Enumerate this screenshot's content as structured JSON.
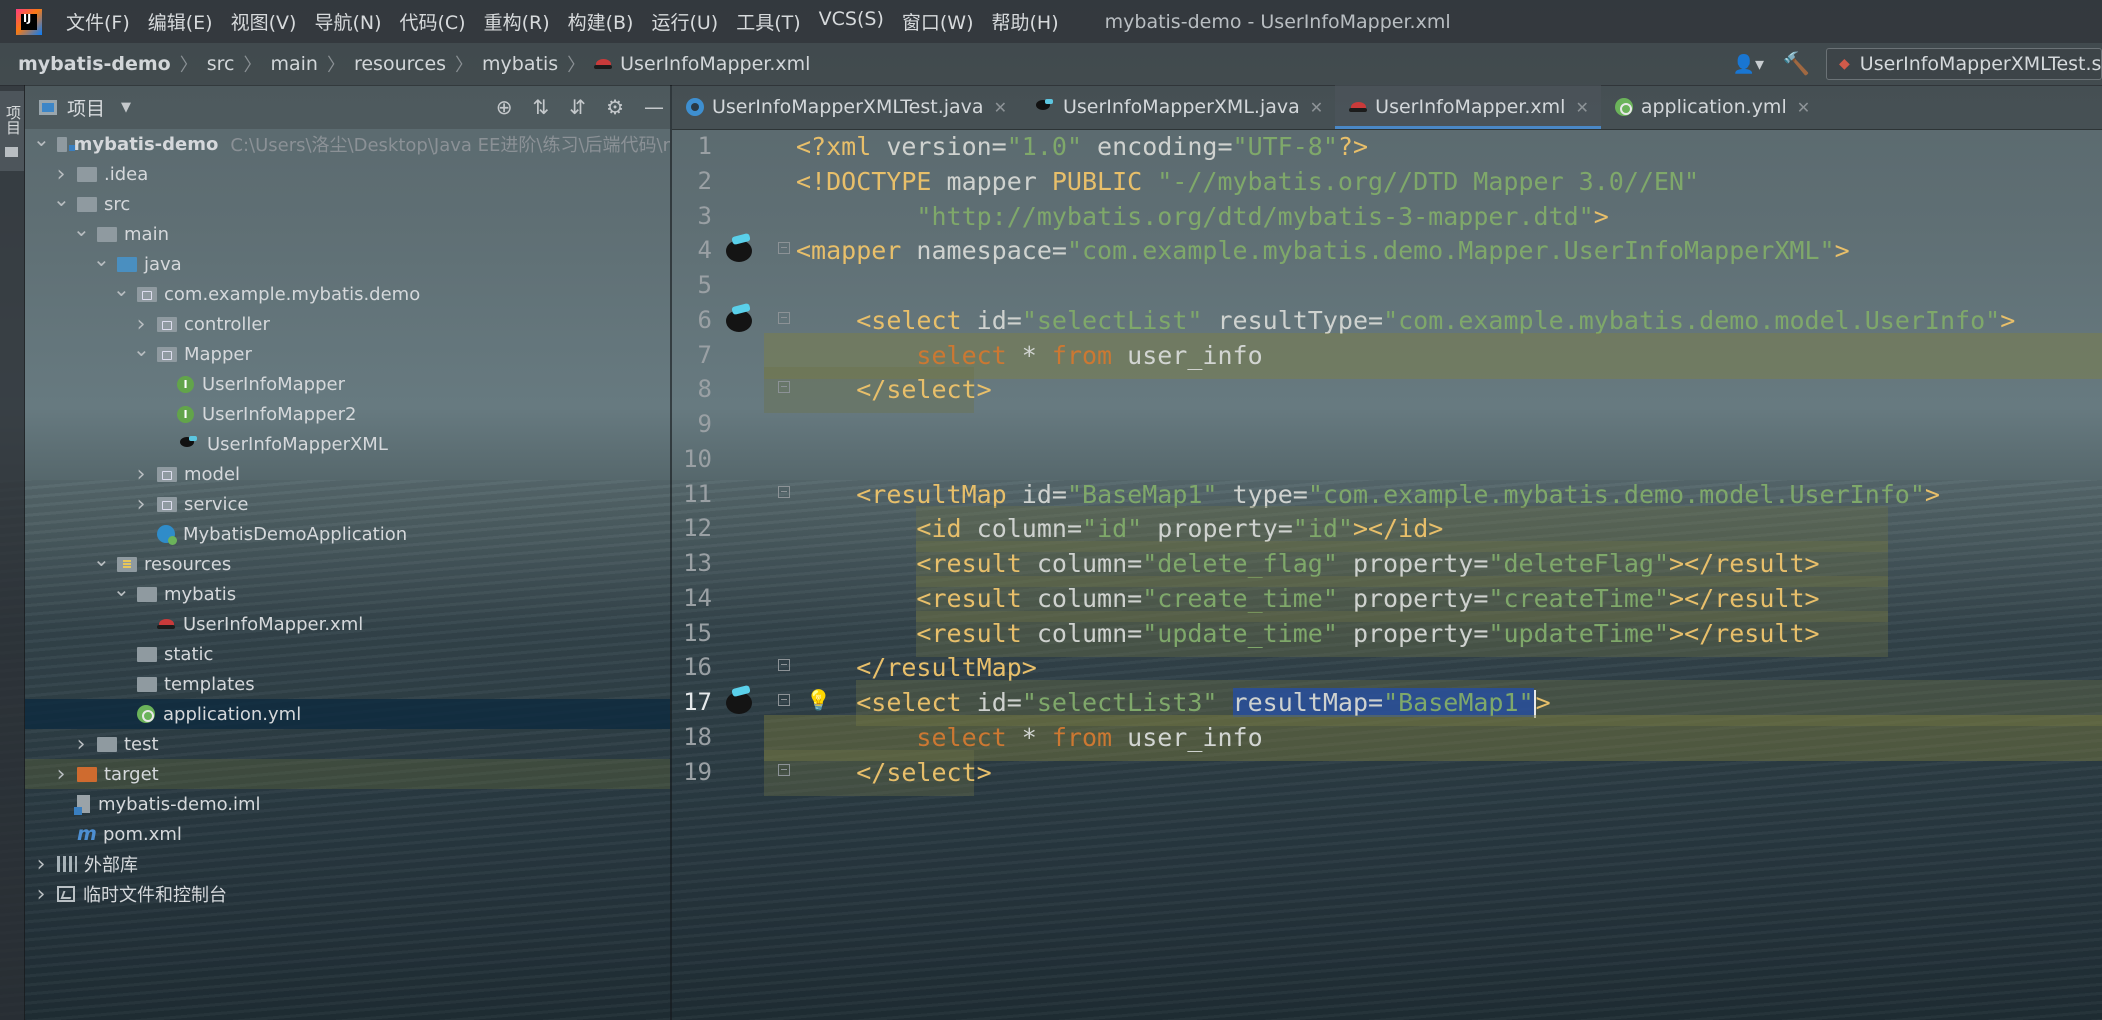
{
  "app": {
    "logo_label": "IJ",
    "window_title": "mybatis-demo - UserInfoMapper.xml",
    "menu": [
      "文件(F)",
      "编辑(E)",
      "视图(V)",
      "导航(N)",
      "代码(C)",
      "重构(R)",
      "构建(B)",
      "运行(U)",
      "工具(T)",
      "VCS(S)",
      "窗口(W)",
      "帮助(H)"
    ]
  },
  "breadcrumb": [
    "mybatis-demo",
    "src",
    "main",
    "resources",
    "mybatis",
    "UserInfoMapper.xml"
  ],
  "toolbar": {
    "run_config": "UserInfoMapperXMLTest.s"
  },
  "tool_strip": {
    "label": "项目"
  },
  "project_panel": {
    "title": "项目",
    "tree": [
      {
        "label": "mybatis-demo",
        "hint": "C:\\Users\\洛尘\\Desktop\\Java EE进阶\\练习\\后端代码\\r",
        "depth": 0,
        "arrow": "open",
        "icon": "module-folder",
        "bold": true
      },
      {
        "label": ".idea",
        "depth": 1,
        "arrow": "closed",
        "icon": "folder"
      },
      {
        "label": "src",
        "depth": 1,
        "arrow": "open",
        "icon": "folder"
      },
      {
        "label": "main",
        "depth": 2,
        "arrow": "open",
        "icon": "folder"
      },
      {
        "label": "java",
        "depth": 3,
        "arrow": "open",
        "icon": "source-folder"
      },
      {
        "label": "com.example.mybatis.demo",
        "depth": 4,
        "arrow": "open",
        "icon": "package"
      },
      {
        "label": "controller",
        "depth": 5,
        "arrow": "closed",
        "icon": "package"
      },
      {
        "label": "Mapper",
        "depth": 5,
        "arrow": "open",
        "icon": "package"
      },
      {
        "label": "UserInfoMapper",
        "depth": 6,
        "arrow": "none",
        "icon": "interface"
      },
      {
        "label": "UserInfoMapper2",
        "depth": 6,
        "arrow": "none",
        "icon": "interface"
      },
      {
        "label": "UserInfoMapperXML",
        "depth": 6,
        "arrow": "none",
        "icon": "mybatis"
      },
      {
        "label": "model",
        "depth": 5,
        "arrow": "closed",
        "icon": "package"
      },
      {
        "label": "service",
        "depth": 5,
        "arrow": "closed",
        "icon": "package"
      },
      {
        "label": "MybatisDemoApplication",
        "depth": 5,
        "arrow": "none",
        "icon": "spring-app"
      },
      {
        "label": "resources",
        "depth": 3,
        "arrow": "open",
        "icon": "resources"
      },
      {
        "label": "mybatis",
        "depth": 4,
        "arrow": "open",
        "icon": "folder"
      },
      {
        "label": "UserInfoMapper.xml",
        "depth": 5,
        "arrow": "none",
        "icon": "xml"
      },
      {
        "label": "static",
        "depth": 4,
        "arrow": "none",
        "icon": "folder"
      },
      {
        "label": "templates",
        "depth": 4,
        "arrow": "none",
        "icon": "folder"
      },
      {
        "label": "application.yml",
        "depth": 4,
        "arrow": "none",
        "icon": "yml",
        "selected": true
      },
      {
        "label": "test",
        "depth": 2,
        "arrow": "closed",
        "icon": "folder"
      },
      {
        "label": "target",
        "depth": 1,
        "arrow": "closed",
        "icon": "excluded-folder",
        "tinted": true
      },
      {
        "label": "mybatis-demo.iml",
        "depth": 1,
        "arrow": "none",
        "icon": "iml"
      },
      {
        "label": "pom.xml",
        "depth": 1,
        "arrow": "none",
        "icon": "maven"
      },
      {
        "label": "外部库",
        "depth": 0,
        "arrow": "closed",
        "icon": "library"
      },
      {
        "label": "临时文件和控制台",
        "depth": 0,
        "arrow": "closed",
        "icon": "scratch"
      }
    ]
  },
  "tabs": [
    {
      "label": "UserInfoMapperXMLTest.java",
      "icon": "java-class",
      "active": false
    },
    {
      "label": "UserInfoMapperXML.java",
      "icon": "mybatis",
      "active": false
    },
    {
      "label": "UserInfoMapper.xml",
      "icon": "xml",
      "active": true
    },
    {
      "label": "application.yml",
      "icon": "yml",
      "active": false
    }
  ],
  "editor": {
    "current_line": 17,
    "lines": [
      {
        "n": 1,
        "tokens": [
          [
            "tag",
            "<?xml "
          ],
          [
            "attr",
            "version"
          ],
          [
            "eq",
            "="
          ],
          [
            "val",
            "\"1.0\""
          ],
          [
            "attr",
            " encoding"
          ],
          [
            "eq",
            "="
          ],
          [
            "val",
            "\"UTF-8\""
          ],
          [
            "tag",
            "?>"
          ]
        ]
      },
      {
        "n": 2,
        "tokens": [
          [
            "tag",
            "<!DOCTYPE "
          ],
          [
            "attr",
            "mapper "
          ],
          [
            "tag",
            "PUBLIC "
          ],
          [
            "val",
            "\"-//mybatis.org//DTD Mapper 3.0//EN\""
          ]
        ]
      },
      {
        "n": 3,
        "tokens": [
          [
            "plain",
            "        "
          ],
          [
            "val",
            "\"http://mybatis.org/dtd/mybatis-3-mapper.dtd\""
          ],
          [
            "tag",
            ">"
          ]
        ]
      },
      {
        "n": 4,
        "bird": true,
        "fold": true,
        "tokens": [
          [
            "tag",
            "<mapper "
          ],
          [
            "attr",
            "namespace"
          ],
          [
            "eq",
            "="
          ],
          [
            "val",
            "\"com.example.mybatis.demo.Mapper.UserInfoMapperXML\""
          ],
          [
            "tag",
            ">"
          ]
        ]
      },
      {
        "n": 5,
        "tokens": []
      },
      {
        "n": 6,
        "bird": true,
        "fold": true,
        "tokens": [
          [
            "plain",
            "    "
          ],
          [
            "tag",
            "<select "
          ],
          [
            "attr",
            "id"
          ],
          [
            "eq",
            "="
          ],
          [
            "val",
            "\"selectList\""
          ],
          [
            "attr",
            " resultType"
          ],
          [
            "eq",
            "="
          ],
          [
            "val",
            "\"com.example.mybatis.demo.model.UserInfo\""
          ],
          [
            "tag",
            ">"
          ]
        ]
      },
      {
        "n": 7,
        "hl": "full",
        "tokens": [
          [
            "plain",
            "        "
          ],
          [
            "kw",
            "select "
          ],
          [
            "plain",
            "* "
          ],
          [
            "kw",
            "from "
          ],
          [
            "plain",
            "user_info"
          ]
        ]
      },
      {
        "n": 8,
        "hl": "short",
        "fold": true,
        "tokens": [
          [
            "plain",
            "    "
          ],
          [
            "tag",
            "</select>"
          ]
        ]
      },
      {
        "n": 9,
        "tokens": []
      },
      {
        "n": 10,
        "tokens": []
      },
      {
        "n": 11,
        "fold": true,
        "tokens": [
          [
            "plain",
            "    "
          ],
          [
            "tag",
            "<resultMap "
          ],
          [
            "attr",
            "id"
          ],
          [
            "eq",
            "="
          ],
          [
            "val",
            "\"BaseMap1\""
          ],
          [
            "attr",
            " type"
          ],
          [
            "eq",
            "="
          ],
          [
            "val",
            "\"com.example.mybatis.demo.model.UserInfo\""
          ],
          [
            "tag",
            ">"
          ]
        ]
      },
      {
        "n": 12,
        "hl": "inner",
        "tokens": [
          [
            "plain",
            "        "
          ],
          [
            "tag",
            "<id "
          ],
          [
            "attr",
            "column"
          ],
          [
            "eq",
            "="
          ],
          [
            "val",
            "\"id\""
          ],
          [
            "attr",
            " property"
          ],
          [
            "eq",
            "="
          ],
          [
            "val",
            "\"id\""
          ],
          [
            "tag",
            "></id>"
          ]
        ]
      },
      {
        "n": 13,
        "hl": "inner",
        "tokens": [
          [
            "plain",
            "        "
          ],
          [
            "tag",
            "<result "
          ],
          [
            "attr",
            "column"
          ],
          [
            "eq",
            "="
          ],
          [
            "val",
            "\"delete_flag\""
          ],
          [
            "attr",
            " property"
          ],
          [
            "eq",
            "="
          ],
          [
            "val",
            "\"deleteFlag\""
          ],
          [
            "tag",
            "></result>"
          ]
        ]
      },
      {
        "n": 14,
        "hl": "inner",
        "tokens": [
          [
            "plain",
            "        "
          ],
          [
            "tag",
            "<result "
          ],
          [
            "attr",
            "column"
          ],
          [
            "eq",
            "="
          ],
          [
            "val",
            "\"create_time\""
          ],
          [
            "attr",
            " property"
          ],
          [
            "eq",
            "="
          ],
          [
            "val",
            "\"createTime\""
          ],
          [
            "tag",
            "></result>"
          ]
        ]
      },
      {
        "n": 15,
        "hl": "inner",
        "tokens": [
          [
            "plain",
            "        "
          ],
          [
            "tag",
            "<result "
          ],
          [
            "attr",
            "column"
          ],
          [
            "eq",
            "="
          ],
          [
            "val",
            "\"update_time\""
          ],
          [
            "attr",
            " property"
          ],
          [
            "eq",
            "="
          ],
          [
            "val",
            "\"updateTime\""
          ],
          [
            "tag",
            "></result>"
          ]
        ]
      },
      {
        "n": 16,
        "fold": true,
        "tokens": [
          [
            "plain",
            "    "
          ],
          [
            "tag",
            "</resultMap>"
          ]
        ]
      },
      {
        "n": 17,
        "bird": true,
        "bulb": true,
        "fold": true,
        "hl": "sel",
        "tokens": [
          [
            "plain",
            "    "
          ],
          [
            "tag",
            "<select "
          ],
          [
            "attr",
            "id"
          ],
          [
            "eq",
            "="
          ],
          [
            "val",
            "\"selectList3\""
          ],
          [
            "plain",
            " "
          ],
          [
            "selattr",
            "resultMap"
          ],
          [
            "seleq",
            "="
          ],
          [
            "selval",
            "\"BaseMap1\""
          ],
          [
            "caret",
            ""
          ],
          [
            "tag",
            ">"
          ]
        ]
      },
      {
        "n": 18,
        "hl": "full",
        "tokens": [
          [
            "plain",
            "        "
          ],
          [
            "kw",
            "select "
          ],
          [
            "plain",
            "* "
          ],
          [
            "kw",
            "from "
          ],
          [
            "plain",
            "user_info"
          ]
        ]
      },
      {
        "n": 19,
        "hl": "short",
        "fold": true,
        "tokens": [
          [
            "plain",
            "    "
          ],
          [
            "tag",
            "</select>"
          ]
        ]
      }
    ]
  }
}
